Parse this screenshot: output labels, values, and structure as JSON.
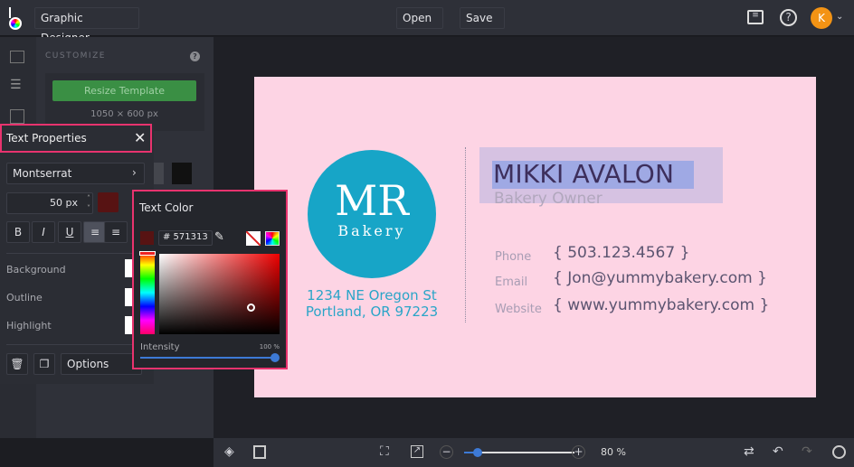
{
  "topbar": {
    "app_name": "Graphic Designer",
    "open_label": "Open",
    "save_label": "Save",
    "avatar_initial": "K"
  },
  "side": {
    "title": "CUSTOMIZE",
    "resize_label": "Resize Template",
    "dimensions": "1050 × 600 px"
  },
  "text_properties": {
    "title": "Text Properties",
    "font": "Montserrat",
    "size": "50 px",
    "bold": "B",
    "italic": "I",
    "underline": "U",
    "background_label": "Background",
    "outline_label": "Outline",
    "highlight_label": "Highlight",
    "options_label": "Options",
    "current_color": "#571313"
  },
  "text_color": {
    "title": "Text Color",
    "hex": "# 571313",
    "intensity_label": "Intensity",
    "intensity_value": "100 %",
    "intensity": 100
  },
  "card": {
    "logo_initials": "MR",
    "logo_sub": "Bakery",
    "address_line1": "1234 NE Oregon St",
    "address_line2": "Portland, OR 97223",
    "name": "MIKKI AVALON",
    "title": "Bakery Owner",
    "contacts": [
      {
        "label": "Phone",
        "value": "{ 503.123.4567 }"
      },
      {
        "label": "Email",
        "value": "{ Jon@yummybakery.com }"
      },
      {
        "label": "Website",
        "value": "{ www.yummybakery.com }"
      }
    ],
    "background": "#fdd4e4",
    "logo_color": "#17a5c7"
  },
  "bottombar": {
    "zoom": "80 %",
    "zoom_value": 80
  }
}
